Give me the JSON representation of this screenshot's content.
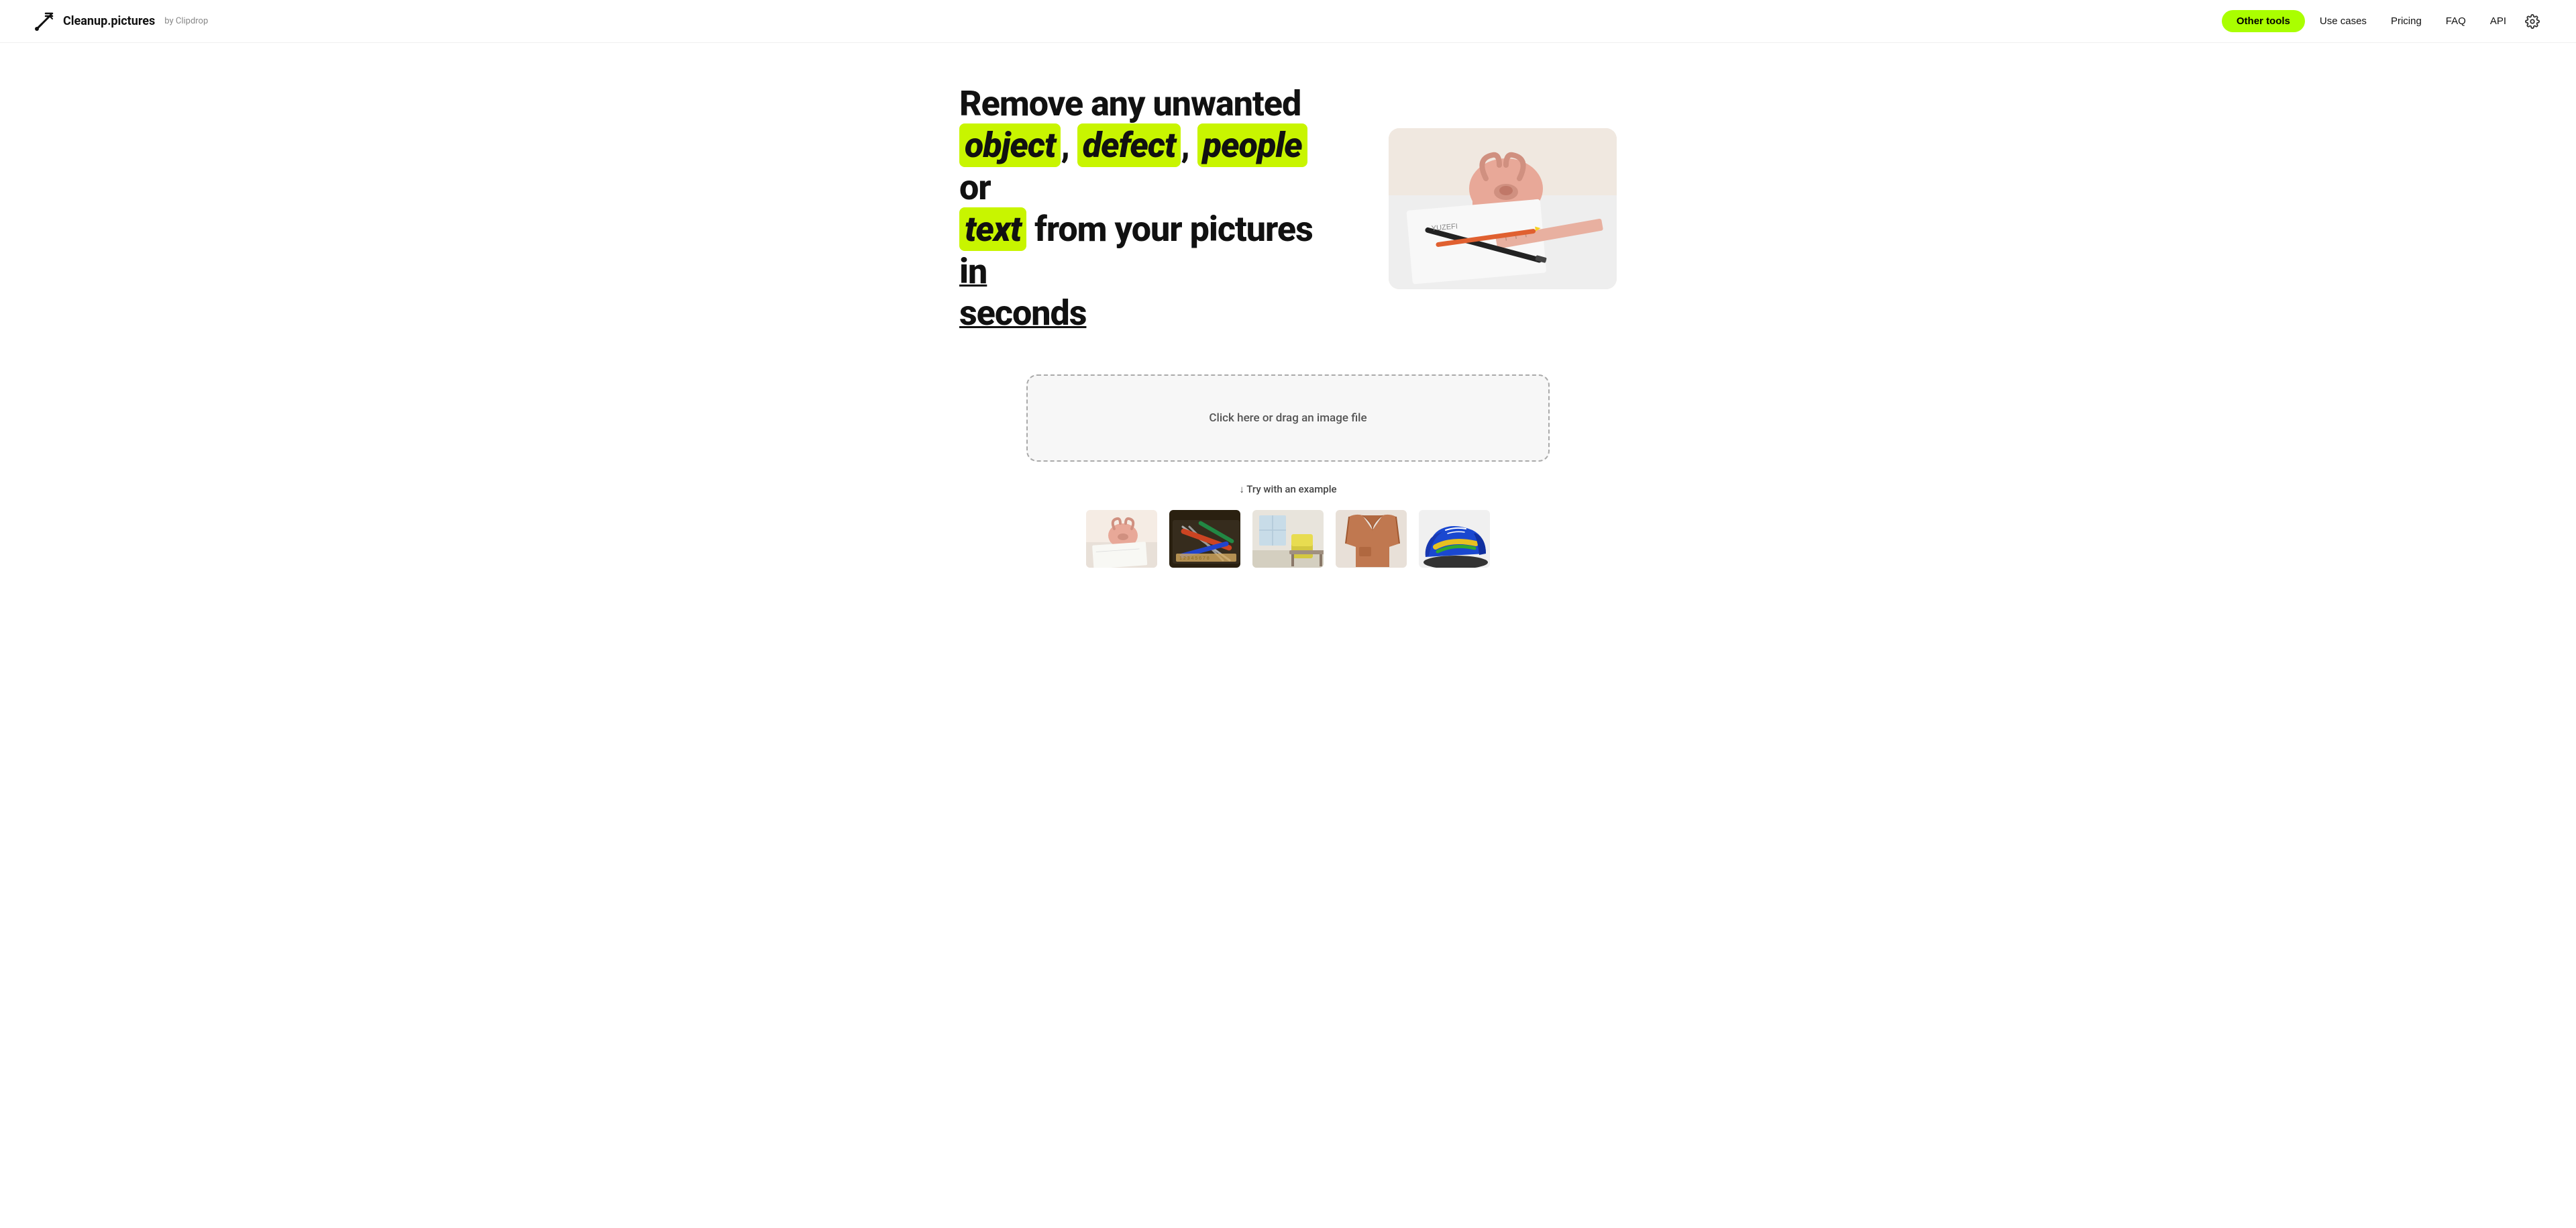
{
  "header": {
    "logo_text": "Cleanup.pictures",
    "logo_by": "by Clipdrop",
    "nav": {
      "other_tools_label": "Other tools",
      "use_cases_label": "Use cases",
      "pricing_label": "Pricing",
      "faq_label": "FAQ",
      "api_label": "API"
    }
  },
  "hero": {
    "heading_prefix": "Remove any unwanted",
    "highlight_1": "object",
    "comma_1": ",",
    "highlight_2": "defect",
    "comma_2": ",",
    "highlight_3": "people",
    "or_text": "or",
    "highlight_4": "text",
    "suffix": "from your pictures",
    "underline_1": "in",
    "underline_2": "seconds"
  },
  "dropzone": {
    "label": "Click here or drag an image file"
  },
  "examples": {
    "try_label": "↓ Try with an example",
    "thumbnails": [
      {
        "id": "thumb-1",
        "alt": "Pink bag example"
      },
      {
        "id": "thumb-2",
        "alt": "Tools on table example"
      },
      {
        "id": "thumb-3",
        "alt": "Room interior example"
      },
      {
        "id": "thumb-4",
        "alt": "Jacket example"
      },
      {
        "id": "thumb-5",
        "alt": "Blue sneaker example"
      }
    ]
  },
  "colors": {
    "highlight_green": "#c8f500",
    "nav_green": "#aaff00",
    "text_dark": "#111111",
    "text_mid": "#555555",
    "border_dashed": "#aaaaaa"
  }
}
